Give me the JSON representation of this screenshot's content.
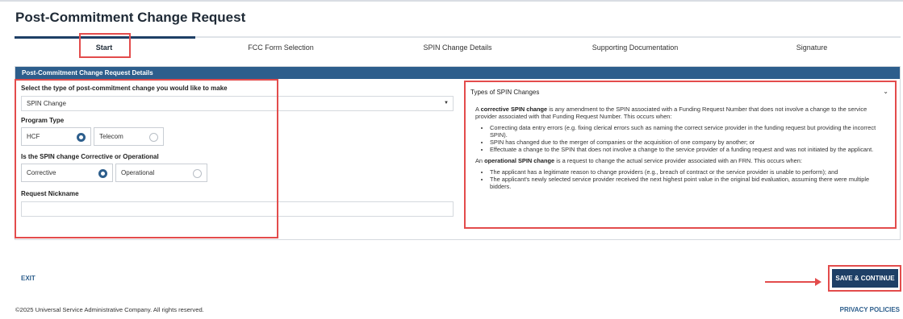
{
  "page": {
    "title": "Post-Commitment Change Request"
  },
  "steps": [
    "Start",
    "FCC Form Selection",
    "SPIN Change Details",
    "Supporting Documentation",
    "Signature"
  ],
  "active_step": "Start",
  "panel": {
    "header": "Post-Commitment Change Request Details"
  },
  "form": {
    "change_type_label": "Select the type of post-commitment change you would like to make",
    "change_type_value": "SPIN Change",
    "program_type_label": "Program Type",
    "program_options": [
      "HCF",
      "Telecom"
    ],
    "program_selected": "HCF",
    "spin_type_label": "Is the SPIN change Corrective or Operational",
    "spin_options": [
      "Corrective",
      "Operational"
    ],
    "spin_selected": "Corrective",
    "nickname_label": "Request Nickname",
    "nickname_value": ""
  },
  "info_panel": {
    "title": "Types of SPIN Changes",
    "corrective_intro_pre": "A ",
    "corrective_term": "corrective SPIN change",
    "corrective_intro_post": " is any amendment to the SPIN associated with a Funding Request Number that does not involve a change to the service provider associated with that Funding Request Number. This occurs when:",
    "corrective_bullets": [
      "Correcting data entry errors (e.g. fixing clerical errors such as naming the correct service provider in the funding request but providing the incorrect SPIN).",
      "SPIN has changed due to the merger of companies or the acquisition of one company by another; or",
      "Effectuate a change to the SPIN that does not involve a change to the service provider of a funding request and was not initiated by the applicant."
    ],
    "operational_intro_pre": "An ",
    "operational_term": "operational SPIN change",
    "operational_intro_post": " is a request to change the actual service provider associated with an FRN. This occurs when:",
    "operational_bullets": [
      "The applicant has a legitimate reason to change providers (e.g., breach of contract or the service provider is unable to perform); and",
      "The applicant's newly selected service provider received the next highest point value in the original bid evaluation, assuming there were multiple bidders."
    ]
  },
  "footer": {
    "exit_label": "EXIT",
    "save_label": "SAVE & CONTINUE",
    "copyright": "©2025 Universal Service Administrative Company. All rights reserved.",
    "privacy_label": "PRIVACY POLICIES"
  },
  "colors": {
    "brand_navy": "#1e3f66",
    "header_blue": "#2d5e8c",
    "annotation_red": "#e34c4c"
  }
}
